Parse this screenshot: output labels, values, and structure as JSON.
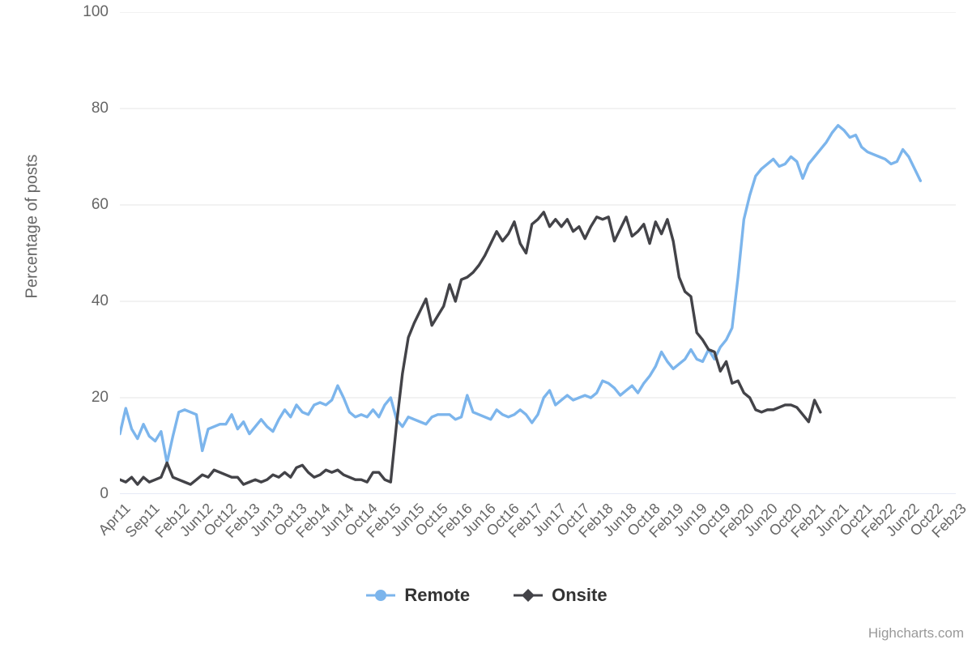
{
  "chart_data": {
    "type": "line",
    "title": "",
    "subtitle": "",
    "xlabel": "",
    "ylabel": "Percentage of posts",
    "ylim": [
      0,
      100
    ],
    "yticks": [
      0,
      20,
      40,
      60,
      80,
      100
    ],
    "grid": true,
    "legend_position": "bottom",
    "credits": "Highcharts.com",
    "x_tick_labels": [
      "Apr11",
      "Sep11",
      "Feb12",
      "Jun12",
      "Oct12",
      "Feb13",
      "Jun13",
      "Oct13",
      "Feb14",
      "Jun14",
      "Oct14",
      "Feb15",
      "Jun15",
      "Oct15",
      "Feb16",
      "Jun16",
      "Oct16",
      "Feb17",
      "Jun17",
      "Oct17",
      "Feb18",
      "Jun18",
      "Oct18",
      "Feb19",
      "Jun19",
      "Oct19",
      "Feb20",
      "Jun20",
      "Oct20",
      "Feb21",
      "Jun21",
      "Oct21",
      "Feb22",
      "Jun22",
      "Oct22",
      "Feb23"
    ],
    "x_tick_indices": [
      0,
      5,
      10,
      14,
      18,
      22,
      26,
      30,
      34,
      38,
      42,
      46,
      50,
      54,
      58,
      62,
      66,
      70,
      74,
      78,
      82,
      86,
      90,
      94,
      98,
      102,
      106,
      110,
      114,
      118,
      122,
      126,
      130,
      134,
      138,
      142
    ],
    "x": [
      "Apr11",
      "May11",
      "Jun11",
      "Jul11",
      "Aug11",
      "Sep11",
      "Oct11",
      "Nov11",
      "Dec11",
      "Jan12",
      "Feb12",
      "Mar12",
      "Apr12",
      "May12",
      "Jun12",
      "Jul12",
      "Aug12",
      "Sep12",
      "Oct12",
      "Nov12",
      "Dec12",
      "Jan13",
      "Feb13",
      "Mar13",
      "Apr13",
      "May13",
      "Jun13",
      "Jul13",
      "Aug13",
      "Sep13",
      "Oct13",
      "Nov13",
      "Dec13",
      "Jan14",
      "Feb14",
      "Mar14",
      "Apr14",
      "May14",
      "Jun14",
      "Jul14",
      "Aug14",
      "Sep14",
      "Oct14",
      "Nov14",
      "Dec14",
      "Jan15",
      "Feb15",
      "Mar15",
      "Apr15",
      "May15",
      "Jun15",
      "Jul15",
      "Aug15",
      "Sep15",
      "Oct15",
      "Nov15",
      "Dec15",
      "Jan16",
      "Feb16",
      "Mar16",
      "Apr16",
      "May16",
      "Jun16",
      "Jul16",
      "Aug16",
      "Sep16",
      "Oct16",
      "Nov16",
      "Dec16",
      "Jan17",
      "Feb17",
      "Mar17",
      "Apr17",
      "May17",
      "Jun17",
      "Jul17",
      "Aug17",
      "Sep17",
      "Oct17",
      "Nov17",
      "Dec17",
      "Jan18",
      "Feb18",
      "Mar18",
      "Apr18",
      "May18",
      "Jun18",
      "Jul18",
      "Aug18",
      "Sep18",
      "Oct18",
      "Nov18",
      "Dec18",
      "Jan19",
      "Feb19",
      "Mar19",
      "Apr19",
      "May19",
      "Jun19",
      "Jul19",
      "Aug19",
      "Sep19",
      "Oct19",
      "Nov19",
      "Dec19",
      "Jan20",
      "Feb20",
      "Mar20",
      "Apr20",
      "May20",
      "Jun20",
      "Jul20",
      "Aug20",
      "Sep20",
      "Oct20",
      "Nov20",
      "Dec20",
      "Jan21",
      "Feb21",
      "Mar21",
      "Apr21",
      "May21",
      "Jun21",
      "Jul21",
      "Aug21",
      "Sep21",
      "Oct21",
      "Nov21",
      "Dec21",
      "Jan22",
      "Feb22",
      "Mar22",
      "Apr22",
      "May22",
      "Jun22",
      "Jul22",
      "Aug22",
      "Sep22",
      "Oct22",
      "Nov22",
      "Dec22",
      "Jan23",
      "Feb23"
    ],
    "series": [
      {
        "name": "Remote",
        "color": "#7cb5ec",
        "marker": "circle",
        "values": [
          12.5,
          17.8,
          13.5,
          11.5,
          14.5,
          12.0,
          11.0,
          13.0,
          6.5,
          12.0,
          17.0,
          17.5,
          17.0,
          16.5,
          9.0,
          13.5,
          14.0,
          14.5,
          14.5,
          16.5,
          13.5,
          15.0,
          12.5,
          14.0,
          15.5,
          14.0,
          13.0,
          15.5,
          17.5,
          16.0,
          18.5,
          17.0,
          16.5,
          18.5,
          19.0,
          18.5,
          19.5,
          22.5,
          20.0,
          17.0,
          16.0,
          16.5,
          16.0,
          17.5,
          16.0,
          18.5,
          20.0,
          15.5,
          14.0,
          16.0,
          15.5,
          15.0,
          14.5,
          16.0,
          16.5,
          16.5,
          16.5,
          15.5,
          16.0,
          20.5,
          17.0,
          16.5,
          16.0,
          15.5,
          17.5,
          16.5,
          16.0,
          16.5,
          17.5,
          16.5,
          14.8,
          16.5,
          20.0,
          21.5,
          18.5,
          19.5,
          20.5,
          19.5,
          20.0,
          20.5,
          20.0,
          21.0,
          23.5,
          23.0,
          22.0,
          20.5,
          21.5,
          22.5,
          21.0,
          23.0,
          24.5,
          26.5,
          29.5,
          27.5,
          26.0,
          27.0,
          28.0,
          30.0,
          28.0,
          27.5,
          30.0,
          28.0,
          30.5,
          32.0,
          34.5,
          45.0,
          57.0,
          62.0,
          66.0,
          67.5,
          68.5,
          69.5,
          68.0,
          68.5,
          70.0,
          69.0,
          65.5,
          68.5,
          70.0,
          71.5,
          73.0,
          75.0,
          76.5,
          75.5,
          74.0,
          74.5,
          72.0,
          71.0,
          70.5,
          70.0,
          69.5,
          68.5,
          69.0,
          71.5,
          70.0,
          67.5,
          65.0
        ]
      },
      {
        "name": "Onsite",
        "color": "#434348",
        "marker": "diamond",
        "values": [
          3.0,
          2.5,
          3.5,
          2.0,
          3.5,
          2.5,
          3.0,
          3.5,
          6.5,
          3.5,
          3.0,
          2.5,
          2.0,
          3.0,
          4.0,
          3.5,
          5.0,
          4.5,
          4.0,
          3.5,
          3.5,
          2.0,
          2.5,
          3.0,
          2.5,
          3.0,
          4.0,
          3.5,
          4.5,
          3.5,
          5.5,
          6.0,
          4.5,
          3.5,
          4.0,
          5.0,
          4.5,
          5.0,
          4.0,
          3.5,
          3.0,
          3.0,
          2.5,
          4.5,
          4.5,
          3.0,
          2.5,
          14.5,
          25.0,
          32.5,
          35.5,
          38.0,
          40.5,
          35.0,
          37.0,
          39.0,
          43.5,
          40.0,
          44.5,
          45.0,
          46.0,
          47.5,
          49.5,
          52.0,
          54.5,
          52.5,
          54.0,
          56.5,
          52.0,
          50.0,
          56.0,
          57.0,
          58.5,
          55.5,
          57.0,
          55.5,
          57.0,
          54.5,
          55.5,
          53.0,
          55.5,
          57.5,
          57.0,
          57.5,
          52.5,
          55.0,
          57.5,
          53.5,
          54.5,
          56.0,
          52.0,
          56.5,
          54.0,
          57.0,
          52.5,
          45.0,
          42.0,
          41.0,
          33.5,
          32.0,
          30.0,
          29.5,
          25.5,
          27.5,
          23.0,
          23.5,
          21.0,
          20.0,
          17.5,
          17.0,
          17.5,
          17.5,
          18.0,
          18.5,
          18.5,
          18.0,
          16.5,
          15.0,
          19.5,
          17.0
        ]
      }
    ]
  },
  "yAxis": {
    "title": "Percentage of posts",
    "ticks": [
      "0",
      "20",
      "40",
      "60",
      "80",
      "100"
    ]
  },
  "legend": {
    "items": [
      {
        "label": "Remote",
        "color": "#7cb5ec",
        "marker": "circle"
      },
      {
        "label": "Onsite",
        "color": "#434348",
        "marker": "diamond"
      }
    ]
  },
  "credits": {
    "text": "Highcharts.com"
  }
}
